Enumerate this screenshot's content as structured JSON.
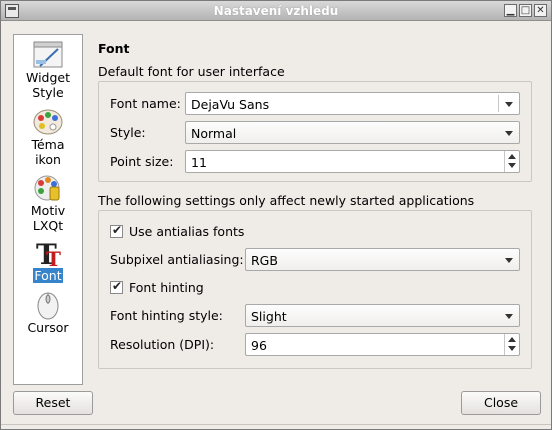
{
  "window": {
    "title": "Nastavení vzhledu"
  },
  "sidebar": {
    "items": [
      {
        "label": "Widget Style",
        "icon": "widget-style-icon"
      },
      {
        "label": "Téma ikon",
        "icon": "icon-theme-icon"
      },
      {
        "label": "Motiv LXQt",
        "icon": "lxqt-theme-icon"
      },
      {
        "label": "Font",
        "icon": "font-icon",
        "selected": true
      },
      {
        "label": "Cursor",
        "icon": "cursor-icon"
      }
    ]
  },
  "font_page": {
    "heading": "Font",
    "default_group": {
      "caption": "Default font for user interface",
      "font_name_label": "Font name:",
      "font_name_value": "DejaVu Sans",
      "style_label": "Style:",
      "style_value": "Normal",
      "point_size_label": "Point size:",
      "point_size_value": "11"
    },
    "new_apps_group": {
      "caption": "The following settings only affect newly started applications",
      "antialias_label": "Use antialias fonts",
      "antialias_checked": true,
      "subpixel_label": "Subpixel antialiasing:",
      "subpixel_value": "RGB",
      "hinting_label": "Font hinting",
      "hinting_checked": true,
      "hinting_style_label": "Font hinting style:",
      "hinting_style_value": "Slight",
      "resolution_label": "Resolution (DPI):",
      "resolution_value": "96"
    }
  },
  "buttons": {
    "reset": "Reset",
    "close": "Close"
  },
  "colors": {
    "selection": "#3584cc",
    "window_bg": "#efebe7"
  }
}
